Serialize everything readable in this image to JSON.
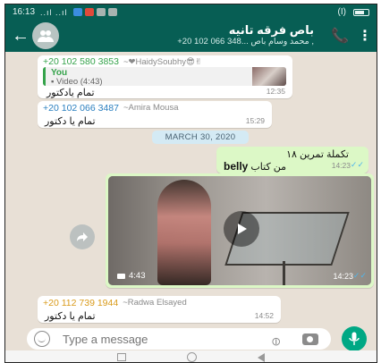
{
  "status_bar": {
    "time": "16:13",
    "signal": "..ıl ..ıl",
    "battery_label": "(I)"
  },
  "header": {
    "group_title": "باص فرقه تانيه",
    "group_participants": "‎+20 102 066 348... محمد وسام باص ,‎",
    "back_icon": "arrow-left-icon",
    "call_icon": "add-call-icon",
    "menu_icon": "more-vertical-icon"
  },
  "messages": [
    {
      "phone": "+20 102 580 3853",
      "name": "~❤HaidySoubhy😎✌",
      "phone_color": "#35a34b",
      "quote": {
        "author": "You",
        "text": "▪ Video (4:43)"
      },
      "text": "تمام يادكتور",
      "time": "12:35"
    },
    {
      "phone": "+20 102 066 3487",
      "name": "~Amira Mousa",
      "phone_color": "#2a7fbf",
      "text": "تمام يا دكتور",
      "time": "15:29"
    },
    {
      "outgoing": true,
      "line1": "تكملة تمرين ١٨",
      "line2_prefix": "belly",
      "line2_suffix": "من كتاب",
      "time": "14:23",
      "ticks": "✓✓"
    },
    {
      "outgoing": true,
      "type": "video",
      "duration": "4:43",
      "time": "14:23",
      "ticks": "✓✓"
    },
    {
      "phone": "+20 112 739 1944",
      "name": "~Radwa Elsayed",
      "phone_color": "#d99a1a",
      "text": "تمام يا دكتور",
      "time": "14:52"
    }
  ],
  "date_chip": "MARCH 30, 2020",
  "input": {
    "placeholder": "Type a message"
  },
  "colors": {
    "header": "#075e54",
    "accent": "#00a884",
    "outgoing_bubble": "#dcf8c6",
    "read_ticks": "#4fb6ec"
  }
}
